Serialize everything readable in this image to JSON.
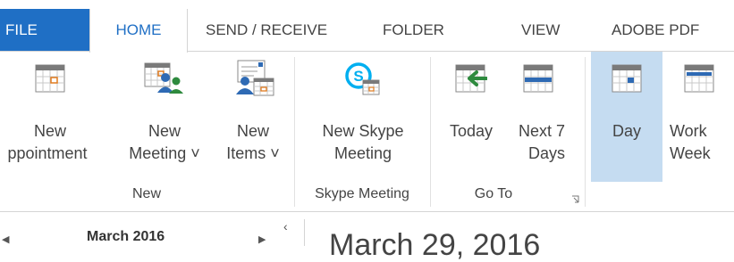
{
  "tabs": {
    "file": "FILE",
    "home": "HOME",
    "send_receive": "SEND / RECEIVE",
    "folder": "FOLDER",
    "view": "VIEW",
    "adobe_pdf": "ADOBE PDF"
  },
  "ribbon": {
    "new_group": {
      "label": "New",
      "new_appointment": [
        "New",
        "ppointment"
      ],
      "new_meeting": [
        "New",
        "Meeting ˅"
      ],
      "new_items": [
        "New",
        "Items ˅"
      ]
    },
    "skype_group": {
      "label": "Skype Meeting",
      "new_skype_meeting": [
        "New Skype",
        "Meeting"
      ]
    },
    "goto_group": {
      "label": "Go To",
      "today": "Today",
      "next7": [
        "Next 7",
        "Days"
      ]
    },
    "arrange_group": {
      "day": "Day",
      "work_week": [
        "Work",
        "Week"
      ]
    }
  },
  "calendar": {
    "month_label": "March 2016",
    "heading": "March 29, 2016"
  },
  "colors": {
    "accent": "#1f6fc5",
    "selected": "#c5dcf1"
  }
}
